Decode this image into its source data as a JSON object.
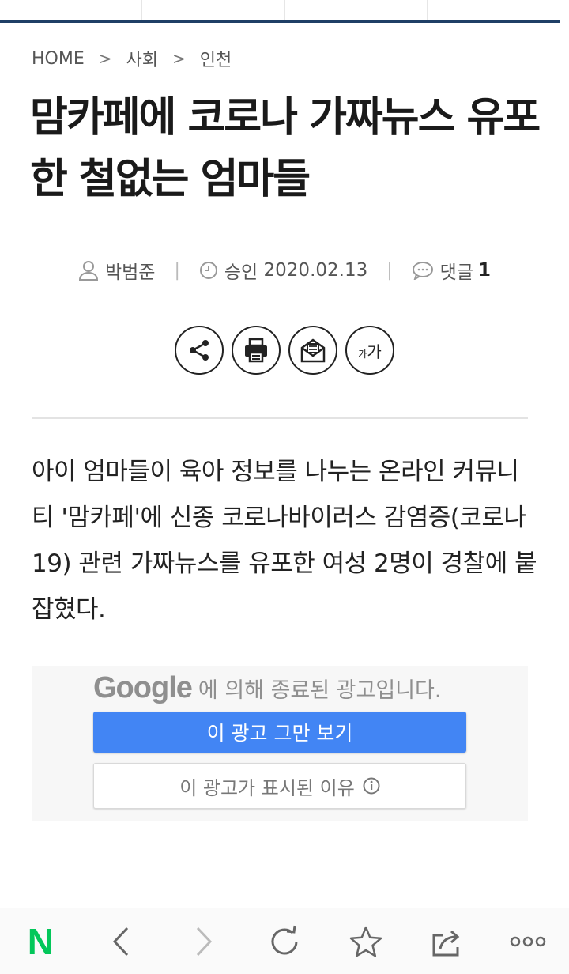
{
  "breadcrumb": {
    "home": "HOME",
    "level1": "사회",
    "level2": "인천",
    "separator": ">"
  },
  "article": {
    "headline": "맘카페에 코로나 가짜뉴스 유포한 철없는 엄마들",
    "author": "박범준",
    "approved_label": "승인",
    "date": "2020.02.13",
    "comments_label": "댓글",
    "comments_count": "1",
    "lead": "아이 엄마들이 육아 정보를 나누는 온라인 커뮤니티 '맘카페'에 신종 코로나바이러스 감염증(코로나19) 관련 가짜뉴스를 유포한 여성 2명이 경찰에 붙잡혔다."
  },
  "tools": {
    "share_icon": "share-icon",
    "print_icon": "print-icon",
    "email_icon": "email-icon",
    "font_small": "가",
    "font_large": "가"
  },
  "ad": {
    "brand": "Google",
    "header_text": "에 의해 종료된 광고입니다.",
    "stop_button": "이 광고 그만 보기",
    "why_button": "이 광고가 표시된 이유",
    "accent_color": "#4285f4"
  },
  "bottom_bar": {
    "logo": "N",
    "logo_color": "#03c75a",
    "more_label": "ooo"
  },
  "colors": {
    "header_rule": "#1f3f66"
  }
}
